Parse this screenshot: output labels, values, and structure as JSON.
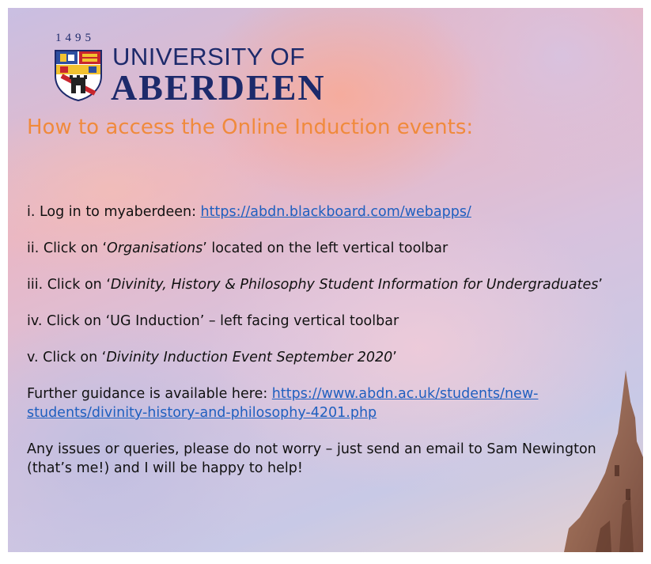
{
  "logo": {
    "year": "1495",
    "line1": "UNIVERSITY OF",
    "line2": "ABERDEEN"
  },
  "title": "How to access the Online Induction events:",
  "steps": {
    "s1": {
      "prefix": "i. Log in to myaberdeen: ",
      "link": "https://abdn.blackboard.com/webapps/"
    },
    "s2": {
      "prefix": "ii. Click on ‘",
      "emph": "Organisations",
      "suffix": "’ located on the left vertical toolbar"
    },
    "s3": {
      "prefix": "iii. Click on ‘",
      "emph": "Divinity, History & Philosophy Student Information for Undergraduates",
      "suffix": "’"
    },
    "s4": {
      "text": "iv. Click on ‘UG Induction’ – left facing vertical toolbar"
    },
    "s5": {
      "prefix": "v. Click on ‘",
      "emph": "Divinity Induction Event September 2020",
      "suffix": "’"
    },
    "s6": {
      "prefix": "Further guidance is available here: ",
      "link": "https://www.abdn.ac.uk/students/new-students/divinity-history-and-philosophy-4201.php"
    },
    "s7": {
      "text": "Any issues or queries, please do not worry – just send an email to Sam Newington (that’s me!) and I will be happy to help!"
    }
  },
  "colors": {
    "title": "#f08a3c",
    "logo": "#1d2a6b",
    "link": "#1f5fbf"
  },
  "icons": {
    "crest": "university-crest",
    "tower": "stone-tower-image"
  }
}
